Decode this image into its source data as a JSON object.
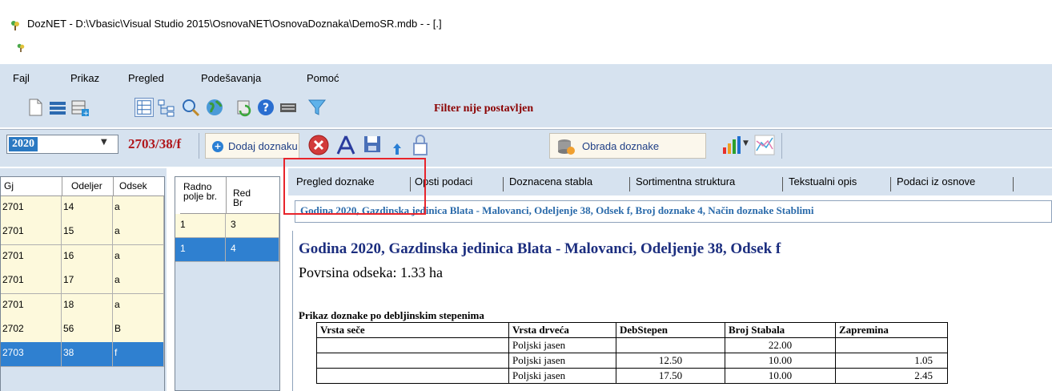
{
  "window": {
    "title": "DozNET - D:\\Vbasic\\Visual Studio 2015\\OsnovaNET\\OsnovaDoznaka\\DemoSR.mdb -  - [.]"
  },
  "menu": {
    "items": [
      "Fajl",
      "Prikaz",
      "Pregled",
      "Podešavanja",
      "Pomoć"
    ]
  },
  "toolbar": {
    "icons": [
      "new-document-icon",
      "list-icon",
      "add-table-icon",
      "grid-icon",
      "tree-icon",
      "magnifier-icon",
      "globe-icon",
      "refresh-icon",
      "help-icon",
      "keyboard-icon",
      "filter-icon"
    ],
    "filter_status": "Filter nije postavljen"
  },
  "toolbar2": {
    "year_value": "2020",
    "code_label": "2703/38/f",
    "add_button": "Dodaj doznaku",
    "process_button": "Obrada doznake",
    "icons": [
      "delete-icon",
      "compass-icon",
      "save-icon",
      "arrow-up-icon",
      "lock-icon",
      "database-icon",
      "bar-chart-icon",
      "dropdown-icon",
      "line-chart-icon"
    ]
  },
  "grid1": {
    "columns": [
      "Gj",
      "Odeljer",
      "Odsek"
    ],
    "rows": [
      [
        "2701",
        "14",
        "a"
      ],
      [
        "2701",
        "15",
        "a"
      ],
      [
        "2701",
        "16",
        "a"
      ],
      [
        "2701",
        "17",
        "a"
      ],
      [
        "2701",
        "18",
        "a"
      ],
      [
        "2702",
        "56",
        "B"
      ],
      [
        "2703",
        "38",
        "f"
      ]
    ],
    "selected_row": 6
  },
  "grid2": {
    "columns": [
      "Radno polje br.",
      "Red Br"
    ],
    "rows": [
      [
        "1",
        "3"
      ],
      [
        "1",
        "4"
      ]
    ],
    "selected_row": 1
  },
  "tabs": [
    "Pregled doznake",
    "Opsti podaci",
    "Doznacena stabla",
    "Sortimentna struktura",
    "Tekstualni opis",
    "Podaci iz osnove"
  ],
  "active_tab": 0,
  "header_bar": "Godina 2020, Gazdinska jedinica Blata - Malovanci, Odeljenje 38, Odsek f, Broj doznake 4, Način doznake Stablimi",
  "report": {
    "heading": "Godina 2020, Gazdinska jedinica Blata - Malovanci, Odeljenje 38, Odsek f",
    "area": "Povrsina odseka: 1.33 ha",
    "section": "Prikaz doznake po debljinskim stepenima",
    "table": {
      "columns": [
        "Vrsta seče",
        "Vrsta drveća",
        "DebStepen",
        "Broj Stabala",
        "Zapremina"
      ],
      "rows": [
        [
          "",
          "Poljski jasen",
          "",
          "22.00",
          ""
        ],
        [
          "",
          "Poljski jasen",
          "12.50",
          "10.00",
          "1.05"
        ],
        [
          "",
          "Poljski jasen",
          "17.50",
          "10.00",
          "2.45"
        ]
      ]
    }
  }
}
